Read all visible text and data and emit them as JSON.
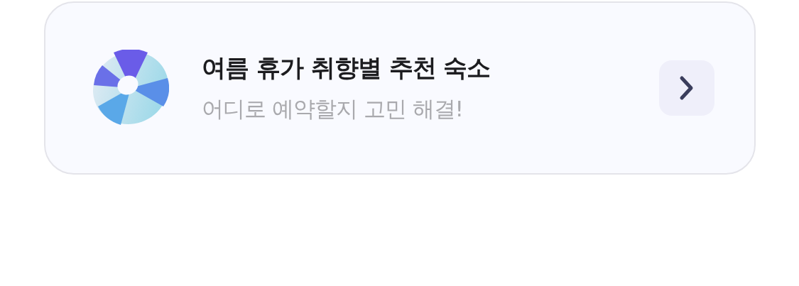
{
  "banner": {
    "title": "여름 휴가 취향별 추천 숙소",
    "subtitle": "어디로 예약할지 고민 해결!"
  }
}
